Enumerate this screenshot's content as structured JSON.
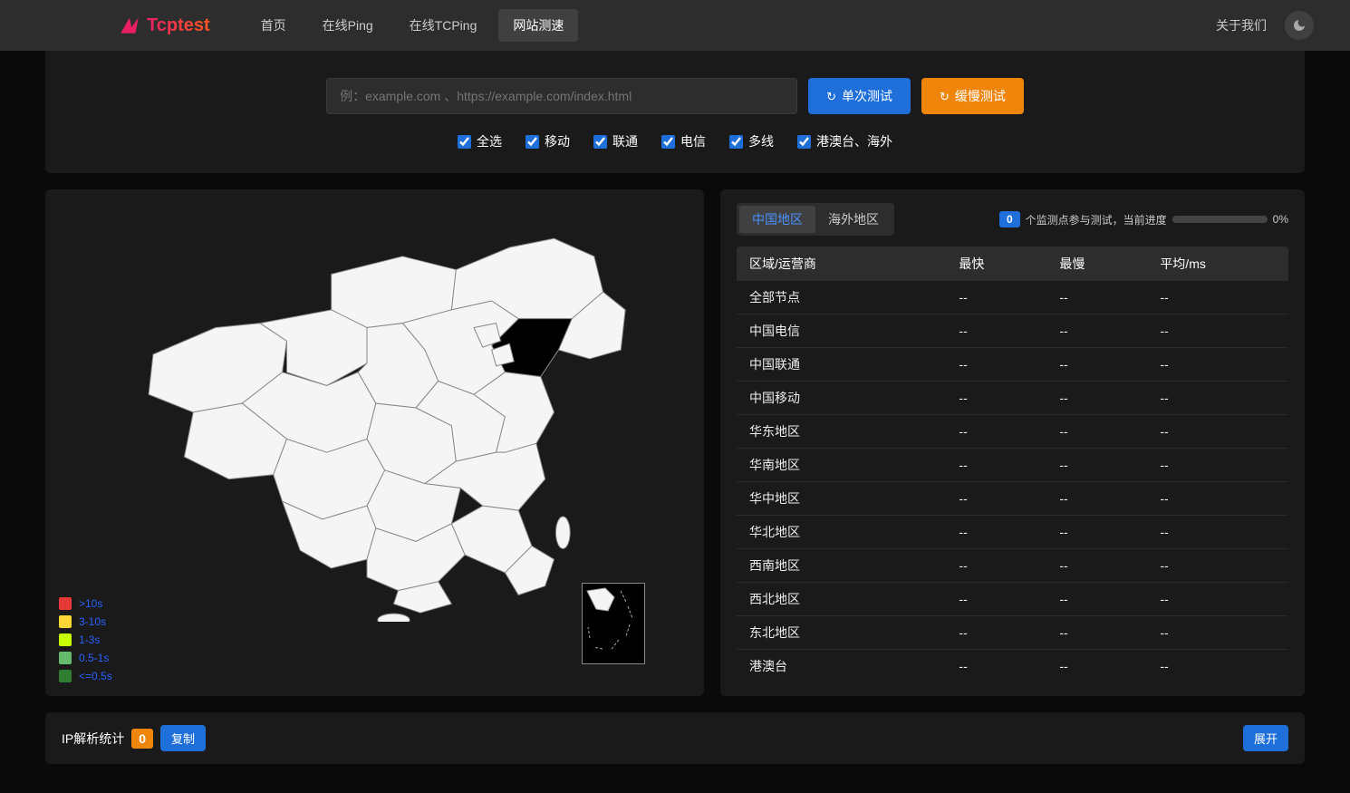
{
  "brand": "Tcptest",
  "nav": [
    {
      "label": "首页",
      "active": false
    },
    {
      "label": "在线Ping",
      "active": false
    },
    {
      "label": "在线TCPing",
      "active": false
    },
    {
      "label": "网站测速",
      "active": true
    }
  ],
  "about": "关于我们",
  "input": {
    "placeholder": "例：example.com 、https://example.com/index.html",
    "single_test": "单次测试",
    "slow_test": "缓慢测试"
  },
  "checkboxes": [
    "全选",
    "移动",
    "联通",
    "电信",
    "多线",
    "港澳台、海外"
  ],
  "legend": [
    {
      "label": ">10s",
      "color": "#e53935"
    },
    {
      "label": "3-10s",
      "color": "#fdd835"
    },
    {
      "label": "1-3s",
      "color": "#c6ff00"
    },
    {
      "label": "0.5-1s",
      "color": "#66bb6a"
    },
    {
      "label": "<=0.5s",
      "color": "#2e7d32"
    }
  ],
  "tabs": {
    "china": "中国地区",
    "overseas": "海外地区"
  },
  "progress": {
    "count": "0",
    "text": "个监测点参与测试，当前进度",
    "percent": "0%"
  },
  "table": {
    "headers": [
      "区域/运营商",
      "最快",
      "最慢",
      "平均/ms"
    ],
    "rows": [
      {
        "region": "全部节点",
        "fast": "--",
        "slow": "--",
        "avg": "--"
      },
      {
        "region": "中国电信",
        "fast": "--",
        "slow": "--",
        "avg": "--"
      },
      {
        "region": "中国联通",
        "fast": "--",
        "slow": "--",
        "avg": "--"
      },
      {
        "region": "中国移动",
        "fast": "--",
        "slow": "--",
        "avg": "--"
      },
      {
        "region": "华东地区",
        "fast": "--",
        "slow": "--",
        "avg": "--"
      },
      {
        "region": "华南地区",
        "fast": "--",
        "slow": "--",
        "avg": "--"
      },
      {
        "region": "华中地区",
        "fast": "--",
        "slow": "--",
        "avg": "--"
      },
      {
        "region": "华北地区",
        "fast": "--",
        "slow": "--",
        "avg": "--"
      },
      {
        "region": "西南地区",
        "fast": "--",
        "slow": "--",
        "avg": "--"
      },
      {
        "region": "西北地区",
        "fast": "--",
        "slow": "--",
        "avg": "--"
      },
      {
        "region": "东北地区",
        "fast": "--",
        "slow": "--",
        "avg": "--"
      },
      {
        "region": "港澳台",
        "fast": "--",
        "slow": "--",
        "avg": "--"
      }
    ]
  },
  "ip": {
    "title": "IP解析统计",
    "count": "0",
    "copy": "复制",
    "expand": "展开"
  }
}
